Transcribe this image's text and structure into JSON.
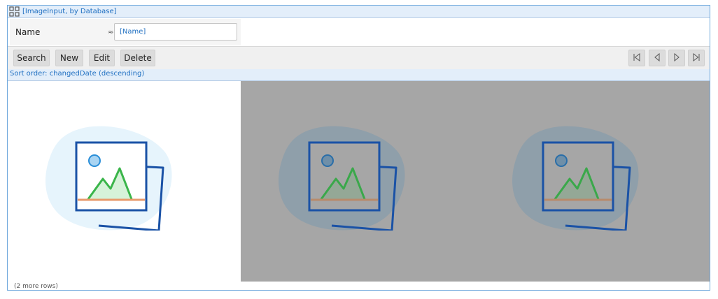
{
  "header": {
    "title": "[ImageInput, by Database]",
    "icon": "grid-icon"
  },
  "filter": {
    "name_label": "Name",
    "operator": "≈",
    "name_placeholder": "[Name]"
  },
  "toolbar": {
    "search_label": "Search",
    "new_label": "New",
    "edit_label": "Edit",
    "delete_label": "Delete",
    "nav_icons": [
      "first-page-icon",
      "previous-page-icon",
      "next-page-icon",
      "last-page-icon"
    ]
  },
  "sort": {
    "text": "Sort order: changedDate (descending)"
  },
  "gallery": {
    "items": [
      {
        "icon": "image-placeholder-icon",
        "selected": false
      },
      {
        "icon": "image-placeholder-icon",
        "selected": true
      },
      {
        "icon": "image-placeholder-icon",
        "selected": true
      }
    ]
  },
  "footer": {
    "more_rows": "(2 more rows)"
  },
  "colors": {
    "accent": "#1f6fc1",
    "frame_border": "#6fa8dc",
    "header_bg": "#e3eefa",
    "dim_overlay": "#a6a6a6"
  }
}
